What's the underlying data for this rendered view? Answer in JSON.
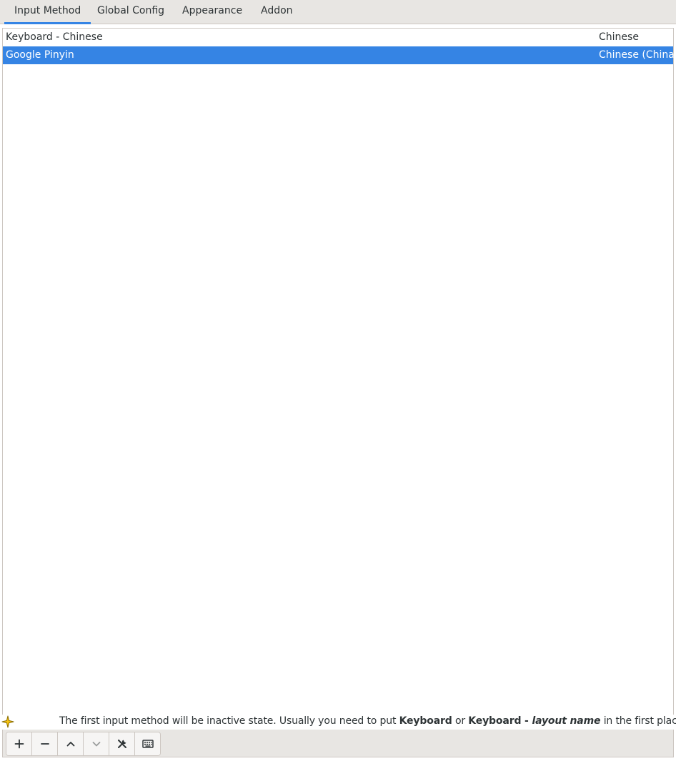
{
  "tabs": [
    {
      "label": "Input Method",
      "active": true
    },
    {
      "label": "Global Config",
      "active": false
    },
    {
      "label": "Appearance",
      "active": false
    },
    {
      "label": "Addon",
      "active": false
    }
  ],
  "input_methods": [
    {
      "name": "Keyboard - Chinese",
      "language": "Chinese",
      "selected": false
    },
    {
      "name": "Google Pinyin",
      "language": "Chinese (China)",
      "selected": true
    }
  ],
  "hint": {
    "icon": "sparkle-icon",
    "part1": "The first input method will be inactive state. Usually you need to put ",
    "bold1": "Keyboard",
    "part2": " or ",
    "bold2": "Keyboard - ",
    "italic": "layout name",
    "part3": " in the first place."
  },
  "toolbar": {
    "buttons": [
      {
        "icon": "add-icon",
        "enabled": true
      },
      {
        "icon": "remove-icon",
        "enabled": true
      },
      {
        "icon": "chevron-up-icon",
        "enabled": true
      },
      {
        "icon": "chevron-down-icon",
        "enabled": false
      },
      {
        "icon": "configure-icon",
        "enabled": true
      },
      {
        "icon": "keyboard-icon",
        "enabled": true
      }
    ]
  },
  "colors": {
    "accent": "#3584e4",
    "toolbar_bg": "#e8e6e3",
    "hint_icon": "#f5c211"
  }
}
